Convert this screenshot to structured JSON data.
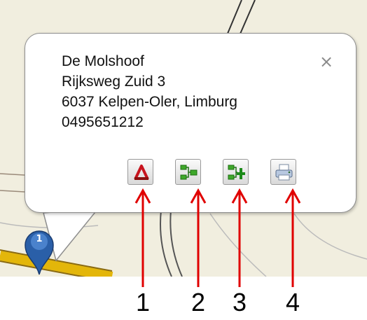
{
  "popup": {
    "name": "De Molshoof",
    "street": "Rijksweg Zuid 3",
    "city": "6037 Kelpen-Oler, Limburg",
    "phone": "0495651212",
    "close_label": "×"
  },
  "map": {
    "marker_number": "1"
  },
  "toolbar": {
    "buttons": [
      {
        "icon": "route-to-icon"
      },
      {
        "icon": "route-from-icon"
      },
      {
        "icon": "add-waypoint-icon"
      },
      {
        "icon": "printer-icon"
      }
    ]
  },
  "annotations": {
    "labels": [
      "1",
      "2",
      "3",
      "4"
    ],
    "arrow_color": "#e00000"
  }
}
